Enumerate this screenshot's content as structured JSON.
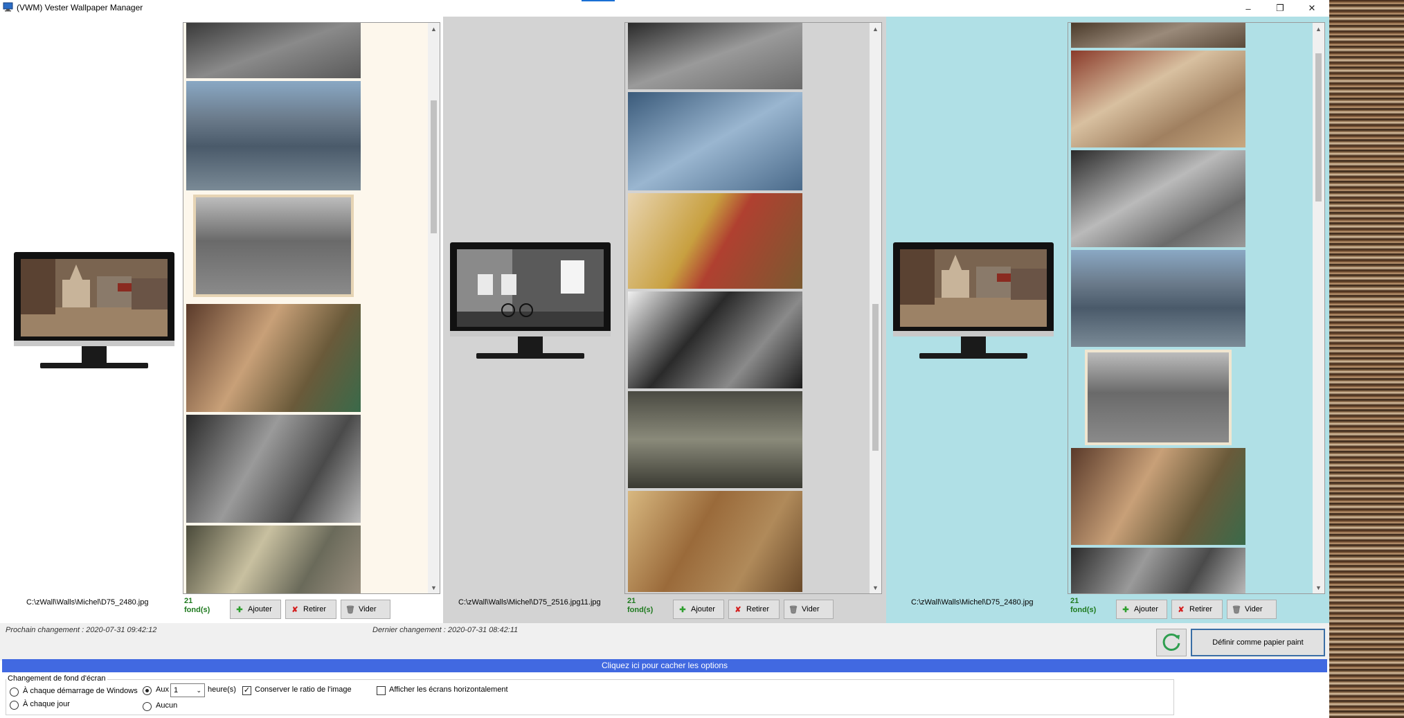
{
  "window": {
    "title": "(VWM) Vester Wallpaper Manager",
    "minimize_icon": "minimize-icon",
    "restore_icon": "restore-icon",
    "close_icon": "close-icon"
  },
  "panels": [
    {
      "path": "C:\\zWall\\Walls\\Michel\\D75_2480.jpg",
      "count_number": "21",
      "count_unit": "fond(s)",
      "background": "#ffffff",
      "list_background": "#fdf7ec"
    },
    {
      "path": "C:\\zWall\\Walls\\Michel\\D75_2516.jpg11.jpg",
      "count_number": "21",
      "count_unit": "fond(s)",
      "background": "#d3d3d3",
      "list_background": "#d3d3d3"
    },
    {
      "path": "C:\\zWall\\Walls\\Michel\\D75_2480.jpg",
      "count_number": "21",
      "count_unit": "fond(s)",
      "background": "#b0e0e6",
      "list_background": "#b0e0e6"
    }
  ],
  "buttons": {
    "add": "Ajouter",
    "remove": "Retirer",
    "clear": "Vider",
    "set_wallpaper": "Définir comme papier paint"
  },
  "status": {
    "next_change": "Prochain changement : 2020-07-31 09:42:12",
    "last_change": "Dernier changement : 2020-07-31 08:42:11"
  },
  "toggle_options": "Cliquez ici pour cacher les options",
  "options": {
    "group_title": "Changement de fond d'écran",
    "each_startup": "À chaque démarrage de Windows",
    "each_day": "À chaque jour",
    "every": "Aux",
    "interval_value": "1",
    "hours": "heure(s)",
    "none": "Aucun",
    "keep_ratio": "Conserver le ratio de l'image",
    "horizontal": "Afficher les écrans horizontalement"
  },
  "colors": {
    "accent_blue": "#4169e1",
    "count_green": "#1f7a1f",
    "refresh_green": "#2e9e4f"
  }
}
